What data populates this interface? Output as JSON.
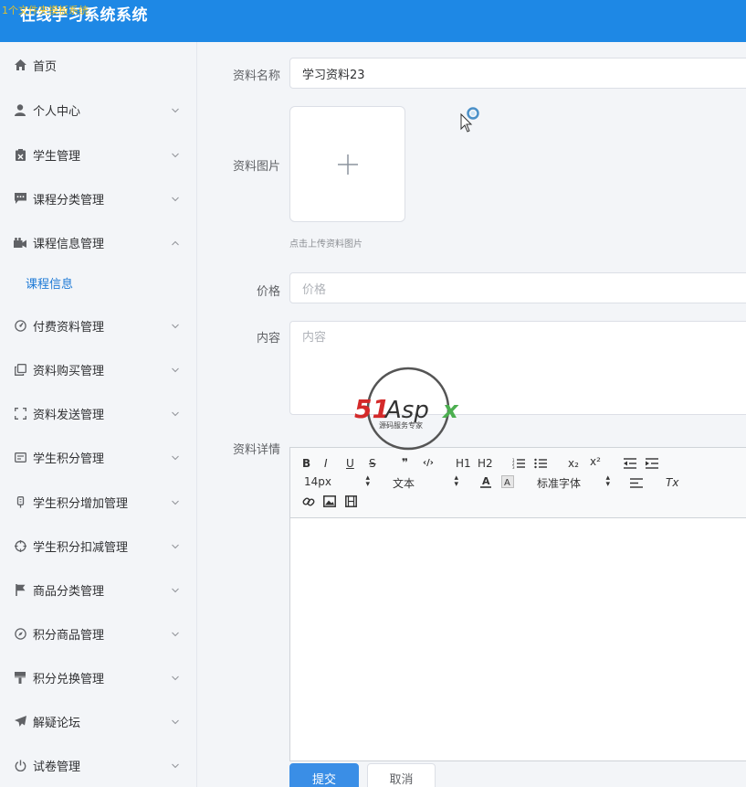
{
  "header": {
    "app_title": "在线学习系统系统",
    "ghost_text": "1个文件夹摸板系统"
  },
  "sidebar": {
    "items": [
      {
        "label": "首页",
        "icon": "home-icon",
        "chevron": "none"
      },
      {
        "label": "个人中心",
        "icon": "user-icon",
        "chevron": "down"
      },
      {
        "label": "学生管理",
        "icon": "clipboard-icon",
        "chevron": "down"
      },
      {
        "label": "课程分类管理",
        "icon": "chat-icon",
        "chevron": "down"
      },
      {
        "label": "课程信息管理",
        "icon": "video-icon",
        "chevron": "up"
      },
      {
        "label": "付费资料管理",
        "icon": "gauge-icon",
        "chevron": "down"
      },
      {
        "label": "资料购买管理",
        "icon": "copy-icon",
        "chevron": "down"
      },
      {
        "label": "资料发送管理",
        "icon": "fullscreen-icon",
        "chevron": "down"
      },
      {
        "label": "学生积分管理",
        "icon": "card-icon",
        "chevron": "down"
      },
      {
        "label": "学生积分增加管理",
        "icon": "mic-icon",
        "chevron": "down"
      },
      {
        "label": "学生积分扣减管理",
        "icon": "crosshair-icon",
        "chevron": "down"
      },
      {
        "label": "商品分类管理",
        "icon": "flag-icon",
        "chevron": "down"
      },
      {
        "label": "积分商品管理",
        "icon": "compass-icon",
        "chevron": "down"
      },
      {
        "label": "积分兑换管理",
        "icon": "brush-icon",
        "chevron": "down"
      },
      {
        "label": "解疑论坛",
        "icon": "send-icon",
        "chevron": "down"
      },
      {
        "label": "试卷管理",
        "icon": "power-icon",
        "chevron": "down"
      }
    ],
    "submenu": {
      "label": "课程信息"
    }
  },
  "form": {
    "name_label": "资料名称",
    "name_value": "学习资料23",
    "image_label": "资料图片",
    "upload_tip": "点击上传资料图片",
    "price_label": "价格",
    "price_placeholder": "价格",
    "content_label": "内容",
    "content_placeholder": "内容",
    "detail_label": "资料详情"
  },
  "editor": {
    "buttons": {
      "bold": "B",
      "italic": "I",
      "underline": "U",
      "strike": "S",
      "quote": "❞",
      "code": "‹/›",
      "h1": "H1",
      "h2": "H2",
      "sub": "x₂",
      "sup": "x²"
    },
    "font_size": "14px",
    "header_select": "文本",
    "font_family": "标准字体",
    "clean": "Tx"
  },
  "actions": {
    "submit": "提交",
    "cancel": "取消"
  },
  "watermark": {
    "brand": "51Aspx",
    "tagline": "源码服务专家"
  },
  "colors": {
    "header_bg": "#1e88e5",
    "primary": "#3a8ee6",
    "active_link": "#1e7ad6"
  }
}
